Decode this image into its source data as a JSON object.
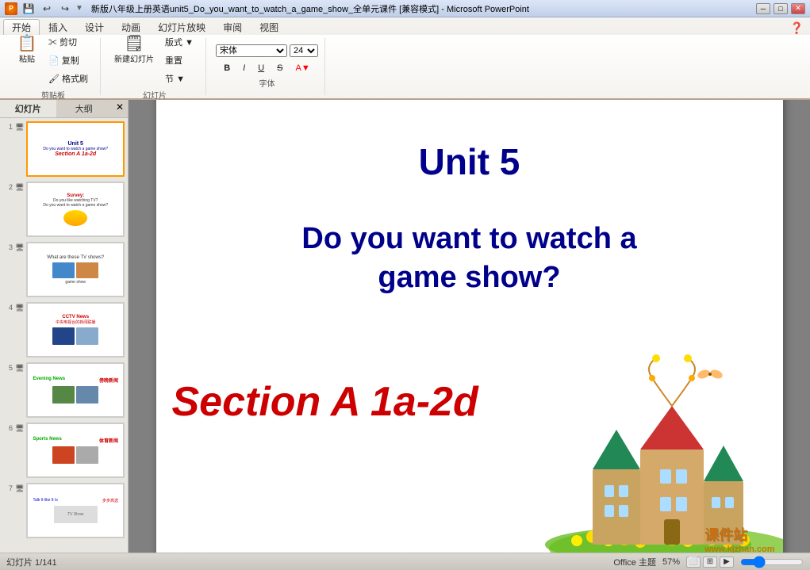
{
  "titlebar": {
    "title": "新版八年级上册英语unit5_Do_you_want_to_watch_a_game_show_全单元课件 [兼容模式] - Microsoft PowerPoint",
    "minimize": "─",
    "maximize": "□",
    "close": "✕"
  },
  "quickaccess": {
    "save": "💾",
    "undo": "↩",
    "redo": "↪"
  },
  "ribbon": {
    "tabs": [
      "开始",
      "插入",
      "设计",
      "动画",
      "幻灯片放映",
      "审阅",
      "视图"
    ],
    "active_tab": "开始"
  },
  "panel": {
    "tab1": "幻灯片",
    "tab2": "大纲"
  },
  "slides": [
    {
      "number": "1",
      "title": "Unit 5",
      "subtitle": "Do you want to watch a game show?",
      "section": "Section A 1a-2d",
      "selected": true
    },
    {
      "number": "2",
      "title": "Survey:",
      "subtitle": "Do you like watching TV? Do you want to watch a game show?",
      "selected": false
    },
    {
      "number": "3",
      "title": "What are these TV shows?",
      "subtitle": "game show",
      "selected": false
    },
    {
      "number": "4",
      "title": "CCTV News",
      "subtitle": "中央电视台的新闻联播",
      "selected": false
    },
    {
      "number": "5",
      "title": "Evening News",
      "subtitle": "傍晚新闻",
      "selected": false
    },
    {
      "number": "6",
      "title": "Sports News",
      "subtitle": "体育新闻",
      "selected": false
    },
    {
      "number": "7",
      "title": "Talk It like It Is",
      "subtitle": "步步高选",
      "selected": false
    }
  ],
  "slide_main": {
    "title": "Unit 5",
    "subtitle": "Do you want to watch a\ngame show?",
    "section": "Section A 1a-2d"
  },
  "statusbar": {
    "info": "幻灯片 1/141",
    "theme": "Office 主题",
    "zoom": "57%"
  },
  "watermark": {
    "site": "课件站",
    "url": "www.kjzhan.com"
  }
}
